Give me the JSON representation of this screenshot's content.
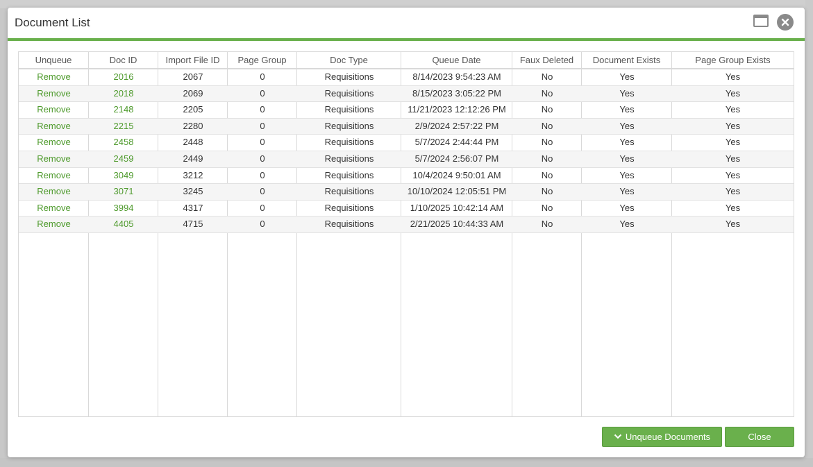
{
  "dialog": {
    "title": "Document List"
  },
  "grid": {
    "columns": [
      "Unqueue",
      "Doc ID",
      "Import File ID",
      "Page Group",
      "Doc Type",
      "Queue Date",
      "Faux Deleted",
      "Document Exists",
      "Page Group Exists"
    ],
    "rows": [
      {
        "unqueue": "Remove",
        "doc_id": "2016",
        "import_file_id": "2067",
        "page_group": "0",
        "doc_type": "Requisitions",
        "queue_date": "8/14/2023 9:54:23 AM",
        "faux_deleted": "No",
        "document_exists": "Yes",
        "page_group_exists": "Yes"
      },
      {
        "unqueue": "Remove",
        "doc_id": "2018",
        "import_file_id": "2069",
        "page_group": "0",
        "doc_type": "Requisitions",
        "queue_date": "8/15/2023 3:05:22 PM",
        "faux_deleted": "No",
        "document_exists": "Yes",
        "page_group_exists": "Yes"
      },
      {
        "unqueue": "Remove",
        "doc_id": "2148",
        "import_file_id": "2205",
        "page_group": "0",
        "doc_type": "Requisitions",
        "queue_date": "11/21/2023 12:12:26 PM",
        "faux_deleted": "No",
        "document_exists": "Yes",
        "page_group_exists": "Yes"
      },
      {
        "unqueue": "Remove",
        "doc_id": "2215",
        "import_file_id": "2280",
        "page_group": "0",
        "doc_type": "Requisitions",
        "queue_date": "2/9/2024 2:57:22 PM",
        "faux_deleted": "No",
        "document_exists": "Yes",
        "page_group_exists": "Yes"
      },
      {
        "unqueue": "Remove",
        "doc_id": "2458",
        "import_file_id": "2448",
        "page_group": "0",
        "doc_type": "Requisitions",
        "queue_date": "5/7/2024 2:44:44 PM",
        "faux_deleted": "No",
        "document_exists": "Yes",
        "page_group_exists": "Yes"
      },
      {
        "unqueue": "Remove",
        "doc_id": "2459",
        "import_file_id": "2449",
        "page_group": "0",
        "doc_type": "Requisitions",
        "queue_date": "5/7/2024 2:56:07 PM",
        "faux_deleted": "No",
        "document_exists": "Yes",
        "page_group_exists": "Yes"
      },
      {
        "unqueue": "Remove",
        "doc_id": "3049",
        "import_file_id": "3212",
        "page_group": "0",
        "doc_type": "Requisitions",
        "queue_date": "10/4/2024 9:50:01 AM",
        "faux_deleted": "No",
        "document_exists": "Yes",
        "page_group_exists": "Yes"
      },
      {
        "unqueue": "Remove",
        "doc_id": "3071",
        "import_file_id": "3245",
        "page_group": "0",
        "doc_type": "Requisitions",
        "queue_date": "10/10/2024 12:05:51 PM",
        "faux_deleted": "No",
        "document_exists": "Yes",
        "page_group_exists": "Yes"
      },
      {
        "unqueue": "Remove",
        "doc_id": "3994",
        "import_file_id": "4317",
        "page_group": "0",
        "doc_type": "Requisitions",
        "queue_date": "1/10/2025 10:42:14 AM",
        "faux_deleted": "No",
        "document_exists": "Yes",
        "page_group_exists": "Yes"
      },
      {
        "unqueue": "Remove",
        "doc_id": "4405",
        "import_file_id": "4715",
        "page_group": "0",
        "doc_type": "Requisitions",
        "queue_date": "2/21/2025 10:44:33 AM",
        "faux_deleted": "No",
        "document_exists": "Yes",
        "page_group_exists": "Yes"
      }
    ]
  },
  "footer": {
    "unqueue_label": "Unqueue Documents",
    "close_label": "Close"
  },
  "icons": {
    "maximize": "window-maximize-icon",
    "close": "close-circle-icon",
    "unqueue": "chevron-down-icon"
  },
  "colors": {
    "accent": "#6ab04c",
    "link": "#4e9a2c",
    "icon_gray": "#8a8a8a"
  }
}
